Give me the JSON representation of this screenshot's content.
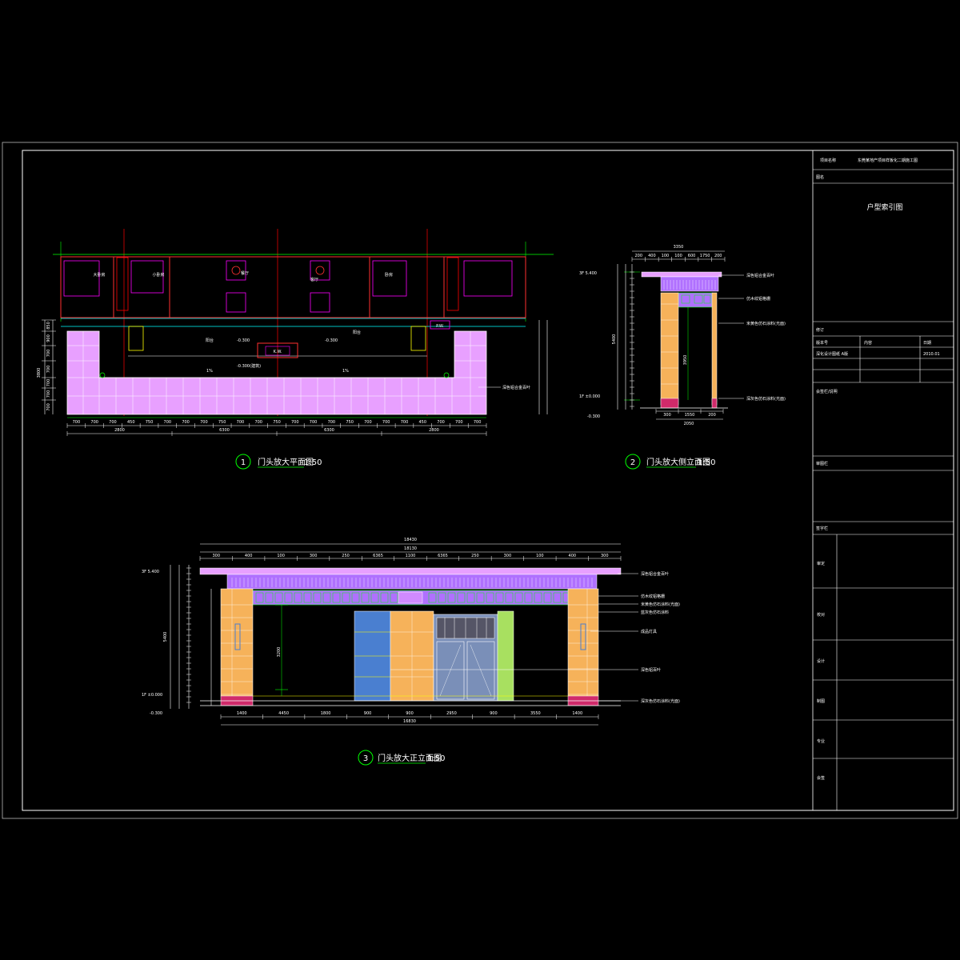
{
  "title_block": {
    "project_label": "项目名称",
    "project_name": "东莞某地产项目样板化二期施工图",
    "drawing_label": "图名",
    "drawing_name": "户型索引图",
    "revision_label": "修订",
    "col_version": "版本号",
    "col_content": "内容",
    "col_date": "日期",
    "row_version": "深化设计图纸 A版",
    "row_date": "2010.01",
    "notes_label": "会签栏/说明",
    "stamp_label": "审图栏",
    "approver_label": "签字栏",
    "roles": [
      "审定",
      "校对",
      "设计",
      "制图",
      "专业",
      "会签"
    ]
  },
  "drawings": {
    "plan": {
      "number": "1",
      "title": "门头放大平面图",
      "scale": "1:50"
    },
    "side": {
      "number": "2",
      "title": "门头放大侧立面图",
      "scale": "1:50"
    },
    "front": {
      "number": "3",
      "title": "门头放大正立面图",
      "scale": "1:50"
    }
  },
  "plan_rooms": {
    "master": "大卧房",
    "small": "小卧房",
    "dining": "餐厅",
    "living": "客厅",
    "bedroom": "卧房",
    "balcony_l": "阳台",
    "balcony_r": "阳台",
    "kw": "K.W.",
    "pw": "P.W."
  },
  "plan_levels": {
    "level1": "-0.300",
    "level2": "-0.300",
    "level3": "-0.300(建筑)",
    "slope_l": "1%",
    "slope_r": "1%"
  },
  "plan_dims_bottom": [
    "700",
    "700",
    "700",
    "450",
    "750",
    "700",
    "700",
    "700",
    "750",
    "700",
    "700",
    "750",
    "700",
    "700",
    "700",
    "750",
    "700",
    "700",
    "700",
    "450",
    "700",
    "700",
    "700"
  ],
  "plan_dims_total": [
    "2800",
    "6300",
    "6300",
    "2800"
  ],
  "plan_dims_left": [
    "850",
    "900",
    "700",
    "700",
    "700",
    "700",
    "700"
  ],
  "plan_dims_left_total": "3800",
  "plan_note": "深色铝合金百叶",
  "side_dims_top": [
    "200",
    "400",
    "100",
    "100",
    "600",
    "1750",
    "200"
  ],
  "side_dims_top_total": "3350",
  "side_dims_bottom": [
    "300",
    "1550",
    "200"
  ],
  "side_dims_bottom_total": "2050",
  "side_levels": {
    "top": "3F 5.400",
    "ground": "1F ±0.000",
    "sub": "-0.300"
  },
  "side_dims_left_total": "5400",
  "side_dims_mid": "3950",
  "side_notes": [
    "深色铝合金百叶",
    "仿木纹铝格栅",
    "米黄色仿石涂料(光面)",
    "深灰色仿石涂料(光面)"
  ],
  "front_dims_top": [
    "300",
    "400",
    "100",
    "300",
    "250",
    "6365",
    "1100",
    "6365",
    "250",
    "300",
    "100",
    "400",
    "300"
  ],
  "front_dims_top_mid": "18130",
  "front_dims_top_total": "18430",
  "front_dims_bottom": [
    "1400",
    "4450",
    "1800",
    "900",
    "900",
    "2950",
    "900",
    "3550",
    "1400"
  ],
  "front_dims_bottom_total": "16830",
  "front_levels": {
    "top": "3F 5.400",
    "ground": "1F ±0.000",
    "sub": "-0.300"
  },
  "front_dims_left_total": "5400",
  "front_dims_mid": "3200",
  "front_notes": [
    "深色铝合金百叶",
    "仿木纹铝格栅",
    "米黄色仿石涂料(光面)",
    "蓝灰色仿石涂料",
    "成品灯具",
    "深色铝百叶",
    "深灰色仿石涂料(光面)"
  ],
  "colors": {
    "frame": "#ffffff",
    "cyan": "#00ffff",
    "green": "#00ff00",
    "magenta": "#ff00ff",
    "red": "#ff0000",
    "yellow": "#ffff00",
    "lilac": "#e8a0ff",
    "violet": "#b070ff",
    "orange": "#f6b25a",
    "blue": "#4a7fd0",
    "pink": "#d02a6a",
    "lime": "#a8e060"
  }
}
